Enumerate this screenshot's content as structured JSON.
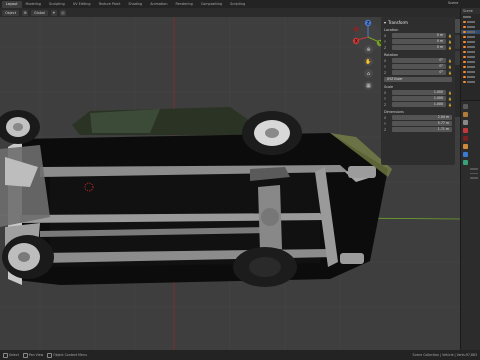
{
  "topbar": {
    "tabs": [
      "Layout",
      "Modeling",
      "Sculpting",
      "UV Editing",
      "Texture Paint",
      "Shading",
      "Animation",
      "Rendering",
      "Compositing",
      "Scripting"
    ],
    "active_tab": 0,
    "scene_label": "Scene"
  },
  "viewport_header": {
    "mode": "Object",
    "orientation": "Global"
  },
  "npanel": {
    "title": "Transform",
    "location_label": "Location",
    "location": {
      "x": "0 m",
      "y": "0 m",
      "z": "0 m"
    },
    "rotation_label": "Rotation",
    "rotation": {
      "x": "0°",
      "y": "0°",
      "z": "0°"
    },
    "rotation_mode": "XYZ Euler",
    "scale_label": "Scale",
    "scale": {
      "x": "1.000",
      "y": "1.000",
      "z": "1.000"
    },
    "dimensions_label": "Dimensions",
    "dimensions": {
      "x": "2.04 m",
      "y": "5.77 m",
      "z": "1.71 m"
    },
    "axis_letters": {
      "x": "X",
      "y": "Y",
      "z": "Z"
    }
  },
  "gizmo": {
    "z_label": "Z",
    "y_label": "Y",
    "x_label": "X"
  },
  "outliner": {
    "header": "Scene"
  },
  "statusbar": {
    "select_label": "Select",
    "pan_label": "Pan View",
    "context_label": "Object Context Menu",
    "stats": "Scene Collection | Vehicle | Verts:97,883"
  },
  "colors": {
    "x_axis": "#8b2d2d",
    "y_axis": "#6ea02d",
    "selection_blue": "#334b6a",
    "accent_orange": "#ff8a2a"
  }
}
